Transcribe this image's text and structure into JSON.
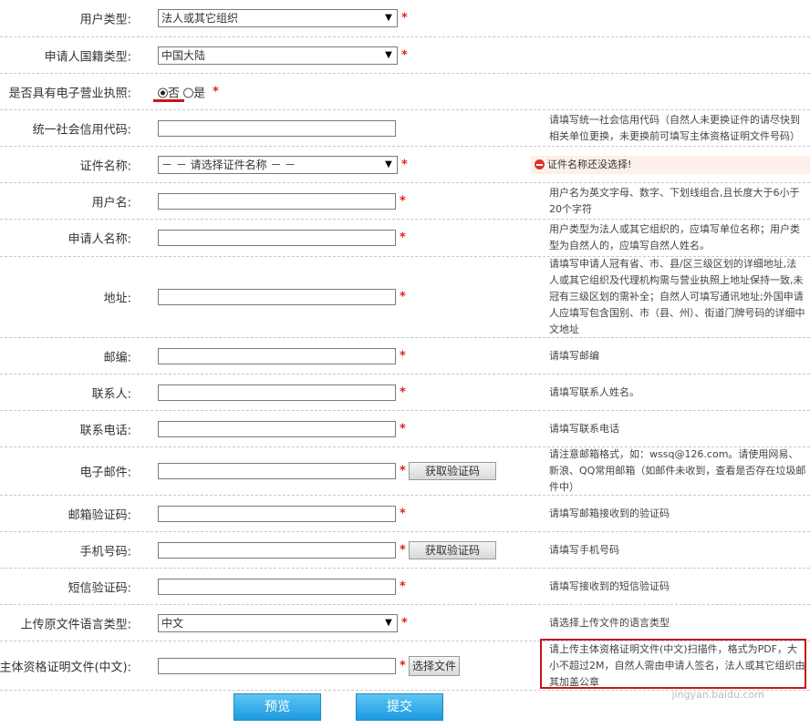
{
  "form": {
    "user_type": {
      "label": "用户类型:",
      "value": "法人或其它组织"
    },
    "nationality": {
      "label": "申请人国籍类型:",
      "value": "中国大陆"
    },
    "license": {
      "label": "是否具有电子营业执照:",
      "option_no": "否",
      "option_yes": "是"
    },
    "credit_code": {
      "label": "统一社会信用代码:",
      "hint": "请填写统一社会信用代码（自然人未更换证件的请尽快到相关单位更换，未更换前可填写主体资格证明文件号码）"
    },
    "cert_name": {
      "label": "证件名称:",
      "value": "－ － 请选择证件名称 － －",
      "error": "证件名称还没选择!"
    },
    "username": {
      "label": "用户名:",
      "hint": "用户名为英文字母、数字、下划线组合,且长度大于6小于20个字符"
    },
    "applicant_name": {
      "label": "申请人名称:",
      "hint": "用户类型为法人或其它组织的，应填写单位名称；用户类型为自然人的，应填写自然人姓名。"
    },
    "address": {
      "label": "地址:",
      "hint": "请填写申请人冠有省、市、县/区三级区划的详细地址,法人或其它组织及代理机构需与营业执照上地址保持一致,未冠有三级区划的需补全；自然人可填写通讯地址;外国申请人应填写包含国别、市（县、州）、街道门牌号码的详细中文地址"
    },
    "postcode": {
      "label": "邮编:",
      "hint": "请填写邮编"
    },
    "contact": {
      "label": "联系人:",
      "hint": "请填写联系人姓名。"
    },
    "phone": {
      "label": "联系电话:",
      "hint": "请填写联系电话"
    },
    "email": {
      "label": "电子邮件:",
      "button": "获取验证码",
      "hint": "请注意邮箱格式，如：wssq@126.com。请使用网易、新浪、QQ常用邮箱（如邮件未收到，查看是否存在垃圾邮件中）"
    },
    "email_code": {
      "label": "邮箱验证码:",
      "hint": "请填写邮箱接收到的验证码"
    },
    "mobile": {
      "label": "手机号码:",
      "button": "获取验证码",
      "hint": "请填写手机号码"
    },
    "sms_code": {
      "label": "短信验证码:",
      "hint": "请填写接收到的短信验证码"
    },
    "language": {
      "label": "上传原文件语言类型:",
      "value": "中文",
      "hint": "请选择上传文件的语言类型"
    },
    "doc": {
      "label": "主体资格证明文件(中文):",
      "button": "选择文件",
      "hint": "请上传主体资格证明文件(中文)扫描件，格式为PDF，大小不超过2M，自然人需由申请人签名，法人或其它组织由其加盖公章"
    },
    "required_mark": "*"
  },
  "actions": {
    "preview": "预览",
    "submit": "提交"
  },
  "watermark": "jingyan.baidu.com",
  "colors": {
    "required": "#e02020",
    "button": "#1e9ae0",
    "highlight": "#c4161c",
    "error_bg": "#fdf0e8"
  }
}
